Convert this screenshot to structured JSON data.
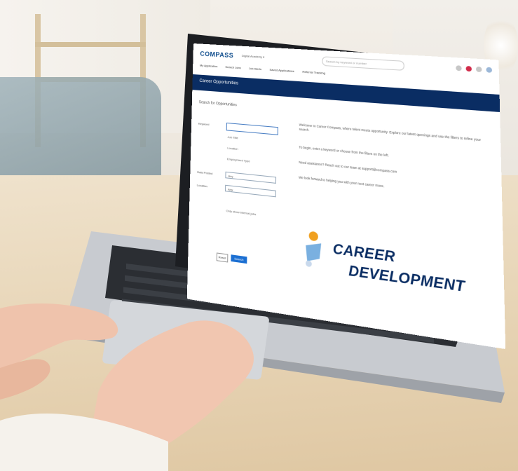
{
  "screen": {
    "logo": "COMPASS",
    "tenant": "Digital Academy ▾",
    "search_placeholder": "Search by keyword or number",
    "nav": [
      "My Application",
      "Search Jobs",
      "Job Alerts",
      "Saved Applications",
      "Referral Tracking"
    ],
    "section_title": "Career Opportunities",
    "form_title": "Search for Opportunities",
    "labels": {
      "keyword": "Keyword",
      "date_posted": "Date Posted",
      "location": "Location"
    },
    "checkboxes": [
      "Job Title",
      "Location",
      "Employment Type"
    ],
    "select_values": {
      "date_posted": "Any",
      "location": "Any"
    },
    "remember_label": "Only show internal jobs",
    "buttons": {
      "reset": "Reset",
      "search": "Search Jobs"
    },
    "info_lines": [
      "Welcome to Career Compass, where talent meets opportunity. Explore our latest openings and use the filters to refine your search.",
      "To begin, enter a keyword or choose from the filters on the left.",
      "Need assistance? Reach out to our team at support@compass.com",
      "We look forward to helping you with your next career move."
    ],
    "career_line1": "CAREER",
    "career_line2": "DEVELOPMENT"
  },
  "colors": {
    "brand_navy": "#0a2d63",
    "accent_blue": "#1b6fd2",
    "logo_orange": "#f0a020"
  }
}
